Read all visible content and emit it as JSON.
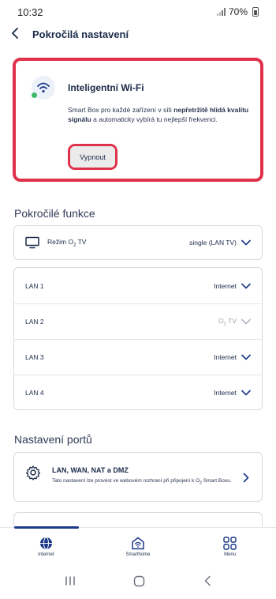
{
  "status": {
    "time": "10:32",
    "battery": "70%"
  },
  "header": {
    "back_label": "<",
    "title": "Pokročilá nastavení"
  },
  "smart_wifi": {
    "title": "Inteligentní Wi-Fi",
    "desc_pre": "Smart Box pro každé zařízení v síti ",
    "desc_bold": "nepřetržitě hlídá kvalitu signálu",
    "desc_post": " a automaticky vybírá tu nejlepší frekvenci.",
    "button": "Vypnout",
    "accent": "#e0314b"
  },
  "advanced": {
    "title": "Pokročilé funkce",
    "tv_mode": {
      "label_pre": "Režim O",
      "label_sub": "2",
      "label_post": " TV",
      "value": "single (LAN TV)"
    }
  },
  "lan": [
    {
      "name": "LAN 1",
      "value": "Internet",
      "disabled": false
    },
    {
      "name": "LAN 2",
      "value_pre": "O",
      "value_sub": "2",
      "value_post": " TV",
      "disabled": true
    },
    {
      "name": "LAN 3",
      "value": "Internet",
      "disabled": false
    },
    {
      "name": "LAN 4",
      "value": "Internet",
      "disabled": false
    }
  ],
  "ports": {
    "title": "Nastavení portů",
    "item_title": "LAN, WAN, NAT a DMZ",
    "item_desc_pre": "Tato nastavení lze provést ve webovém rozhraní při připojení k O",
    "item_desc_sub": "2",
    "item_desc_post": " Smart Boxu."
  },
  "nav": {
    "internet": "Internet",
    "smarthome": "Smarthome",
    "menu": "Menu",
    "active_color": "#1d3a8a"
  }
}
